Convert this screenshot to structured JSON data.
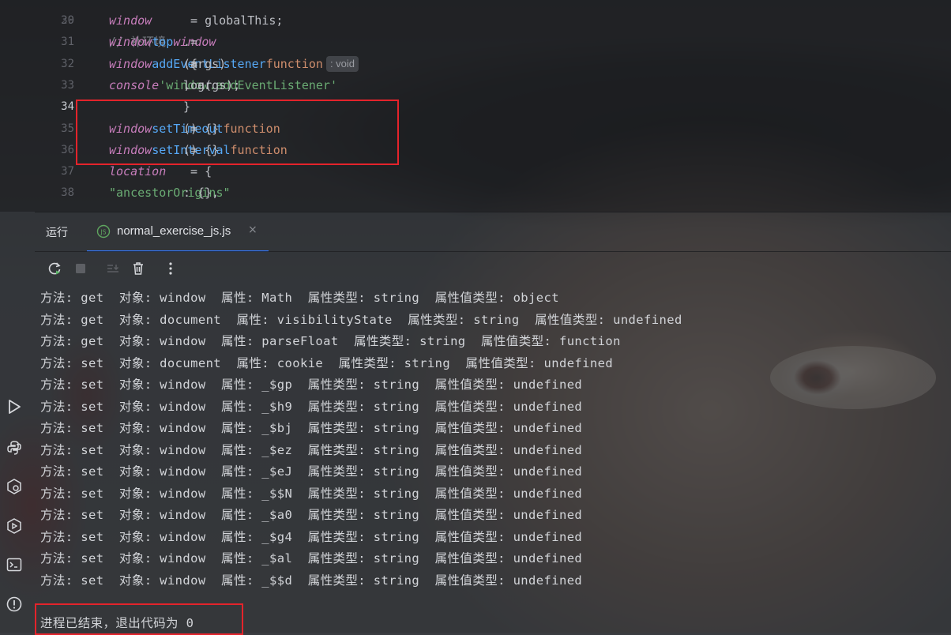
{
  "editor": {
    "top_fragment": "// 补环境",
    "lines": [
      {
        "num": "30",
        "parts": [
          [
            "kw-var",
            "window"
          ],
          [
            "code",
            " = globalThis;"
          ]
        ]
      },
      {
        "num": "31",
        "parts": [
          [
            "kw-var",
            "window"
          ],
          [
            "code",
            "."
          ],
          [
            "prop",
            "top"
          ],
          [
            "code",
            " = "
          ],
          [
            "kw-var",
            "window"
          ]
        ]
      },
      {
        "num": "32",
        "parts": [
          [
            "kw-var",
            "window"
          ],
          [
            "code",
            "."
          ],
          [
            "prop",
            "addEventListener"
          ],
          [
            "code",
            " = "
          ],
          [
            "fn-kw",
            "function"
          ],
          [
            "code",
            "(args)"
          ],
          [
            "hint",
            ": void"
          ],
          [
            "code",
            " {"
          ]
        ]
      },
      {
        "num": "33",
        "parts": [
          [
            "code",
            "    "
          ],
          [
            "kw-var",
            "console"
          ],
          [
            "code",
            "."
          ],
          [
            "code",
            "log("
          ],
          [
            "str",
            "'window.addEventListener'"
          ],
          [
            "code",
            ", args);"
          ]
        ]
      },
      {
        "num": "34",
        "parts": [
          [
            "code",
            "}"
          ]
        ],
        "current": true
      },
      {
        "num": "35",
        "parts": [
          [
            "kw-var",
            "window"
          ],
          [
            "code",
            "."
          ],
          [
            "prop",
            "setTimeout"
          ],
          [
            "code",
            " = "
          ],
          [
            "fn-kw",
            "function"
          ],
          [
            "code",
            "() {}"
          ]
        ]
      },
      {
        "num": "36",
        "parts": [
          [
            "kw-var",
            "window"
          ],
          [
            "code",
            "."
          ],
          [
            "prop",
            "setInterval"
          ],
          [
            "code",
            " = "
          ],
          [
            "fn-kw",
            "function"
          ],
          [
            "code",
            "() {}"
          ]
        ]
      },
      {
        "num": "37",
        "parts": [
          [
            "kw-var",
            "location"
          ],
          [
            "code",
            " = {"
          ]
        ]
      },
      {
        "num": "38",
        "parts": [
          [
            "code",
            "    "
          ],
          [
            "str",
            "\"ancestorOrigins\""
          ],
          [
            "code",
            ": {},"
          ]
        ]
      }
    ]
  },
  "run_window": {
    "title": "运行",
    "tab_label": "normal_exercise_js.js",
    "tab_close": "×"
  },
  "toolstrip_icons": [
    "run-icon",
    "python-packages-icon",
    "services-icon",
    "debug-icon",
    "terminal-icon",
    "problems-icon"
  ],
  "toolbar_icons": [
    "rerun-icon",
    "stop-icon",
    "scroll-to-end-icon",
    "clear-all-icon",
    "more-options-icon"
  ],
  "console": {
    "lines": [
      "方法: get  对象: window  属性: Math  属性类型: string  属性值类型: object",
      "方法: get  对象: document  属性: visibilityState  属性类型: string  属性值类型: undefined",
      "方法: get  对象: window  属性: parseFloat  属性类型: string  属性值类型: function",
      "方法: set  对象: document  属性: cookie  属性类型: string  属性值类型: undefined",
      "方法: set  对象: window  属性: _$gp  属性类型: string  属性值类型: undefined",
      "方法: set  对象: window  属性: _$h9  属性类型: string  属性值类型: undefined",
      "方法: set  对象: window  属性: _$bj  属性类型: string  属性值类型: undefined",
      "方法: set  对象: window  属性: _$ez  属性类型: string  属性值类型: undefined",
      "方法: set  对象: window  属性: _$eJ  属性类型: string  属性值类型: undefined",
      "方法: set  对象: window  属性: _$$N  属性类型: string  属性值类型: undefined",
      "方法: set  对象: window  属性: _$a0  属性类型: string  属性值类型: undefined",
      "方法: set  对象: window  属性: _$g4  属性类型: string  属性值类型: undefined",
      "方法: set  对象: window  属性: _$al  属性类型: string  属性值类型: undefined",
      "方法: set  对象: window  属性: _$$d  属性类型: string  属性值类型: undefined"
    ],
    "exit_message": "进程已结束，退出代码为 0"
  },
  "colors": {
    "highlight_box": "#e4232b",
    "tab_underline": "#3574f0"
  }
}
